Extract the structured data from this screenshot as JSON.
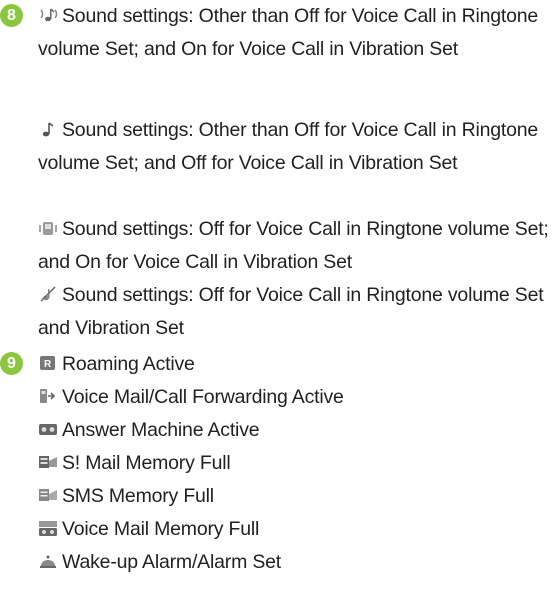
{
  "sections": [
    {
      "number": "8",
      "items": [
        {
          "icon": "ringtone-vibration-icon",
          "text": "Sound settings: Other than Off for Voice Call in Ringtone volume Set; and On for Voice Call in Vibration Set"
        },
        {
          "icon": "ringtone-only-icon",
          "text": "Sound settings: Other than Off for Voice Call in Ringtone volume Set; and Off for Voice Call in Vibration Set"
        },
        {
          "icon": "vibration-only-icon",
          "text": "Sound settings: Off for Voice Call in Ringtone volume Set; and On for Voice Call in Vibration Set"
        },
        {
          "icon": "silent-icon",
          "text": "Sound settings: Off for Voice Call in Ringtone volume Set and Vibration Set"
        }
      ]
    },
    {
      "number": "9",
      "items": [
        {
          "icon": "roaming-icon",
          "text": "Roaming Active"
        },
        {
          "icon": "call-forwarding-icon",
          "text": "Voice Mail/Call Forwarding Active"
        },
        {
          "icon": "answer-machine-icon",
          "text": "Answer Machine Active"
        },
        {
          "icon": "smail-memory-full-icon",
          "text": "S! Mail Memory Full"
        },
        {
          "icon": "sms-memory-full-icon",
          "text": "SMS Memory Full"
        },
        {
          "icon": "voice-mail-memory-full-icon",
          "text": "Voice Mail Memory Full"
        },
        {
          "icon": "alarm-icon",
          "text": "Wake-up Alarm/Alarm Set"
        }
      ]
    }
  ]
}
